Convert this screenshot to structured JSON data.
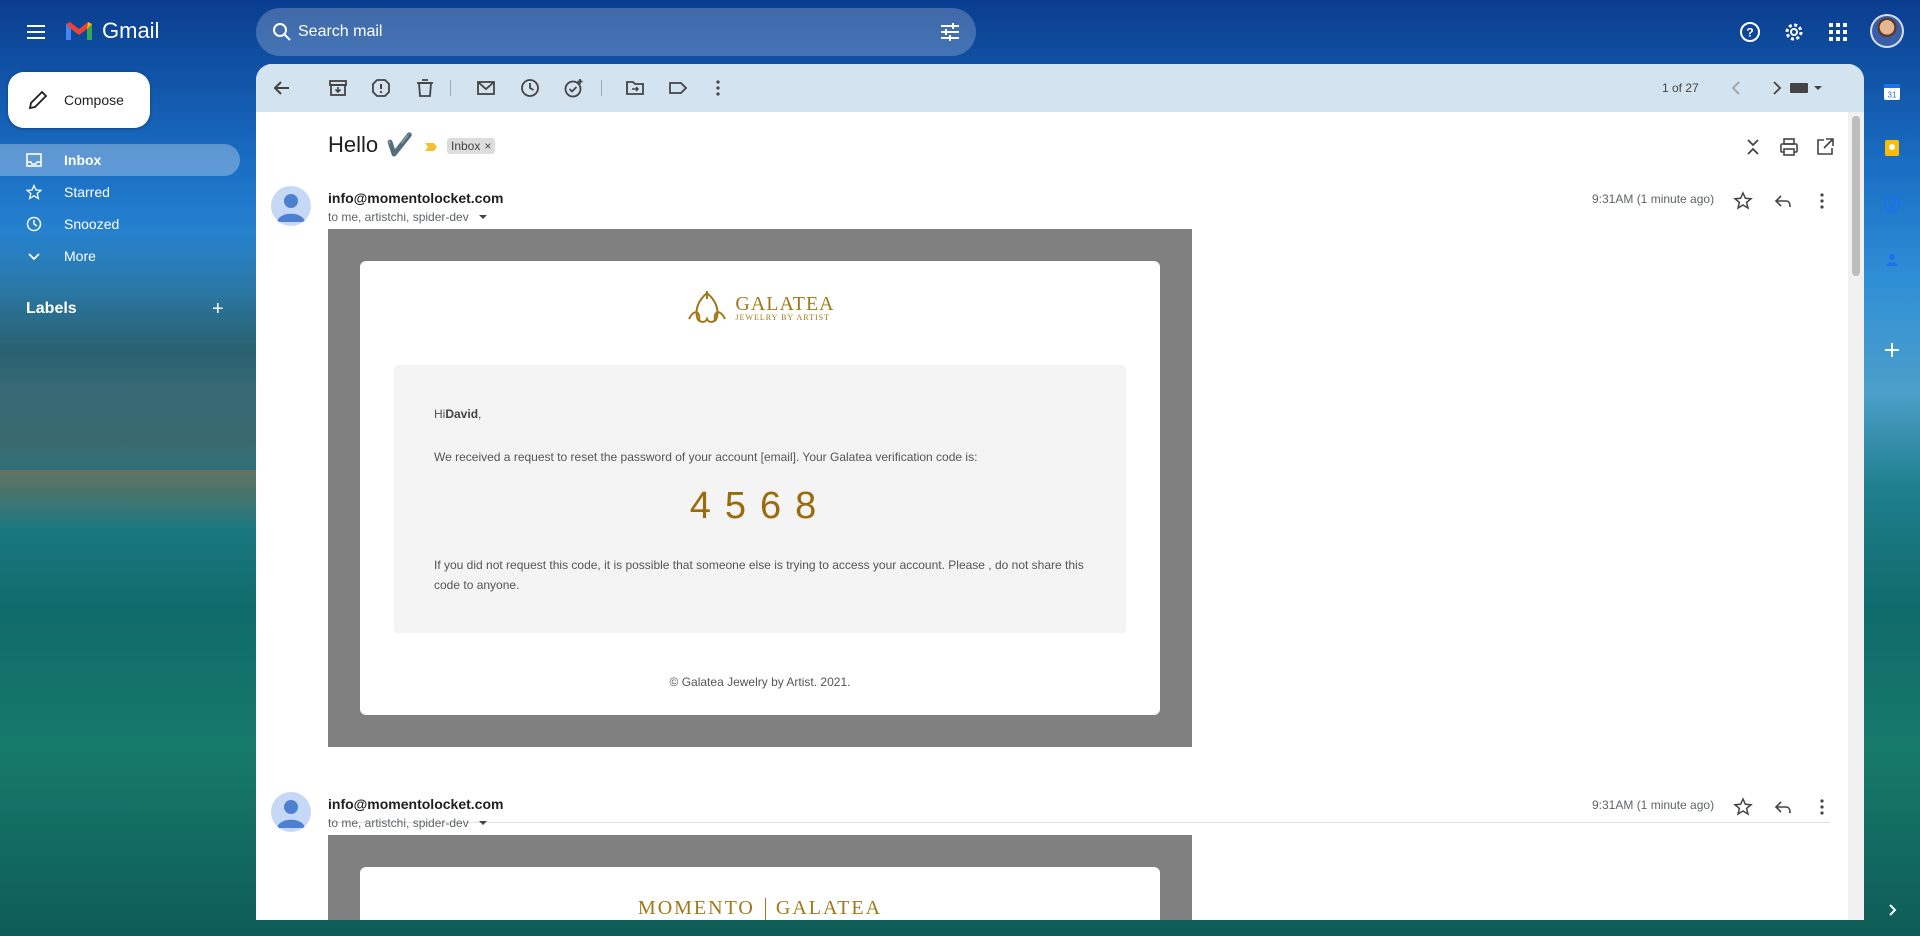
{
  "app": {
    "name": "Gmail"
  },
  "search": {
    "placeholder": "Search mail"
  },
  "sidebar": {
    "compose_label": "Compose",
    "items": [
      {
        "label": "Inbox",
        "icon": "inbox-icon",
        "active": true
      },
      {
        "label": "Starred",
        "icon": "star-icon"
      },
      {
        "label": "Snoozed",
        "icon": "clock-icon"
      },
      {
        "label": "More",
        "icon": "chevron-down-icon"
      }
    ],
    "labels_heading": "Labels"
  },
  "toolbar": {
    "pager": "1 of 27"
  },
  "thread": {
    "subject": "Hello",
    "subject_emoji": "✔️",
    "chip_label": "Inbox",
    "chip_close": "×"
  },
  "messages": [
    {
      "sender": "info@momentolocket.com",
      "recipients": "to me, artistchi, spider-dev",
      "time": "9:31AM (1 minute ago)",
      "brand_name": "GALATEA",
      "brand_sub": "JEWELRY BY ARTIST",
      "greeting_prefix": "Hi",
      "greeting_name": "David",
      "greeting_suffix": ",",
      "body": "We received a request to reset the password of your account [email]. Your Galatea verification code is:",
      "code": "4568",
      "warning": "If you did not request this code, it is possible that someone else is trying to access your account. Please , do not share this code to anyone.",
      "footer": "© Galatea Jewelry by Artist. 2021."
    },
    {
      "sender": "info@momentolocket.com",
      "recipients": "to me, artistchi, spider-dev",
      "time": "9:31AM (1 minute ago)",
      "brand_name": "MOMENTO",
      "brand_sub": "GALATEA"
    }
  ],
  "colors": {
    "accent": "#a07818",
    "code": "#9a6a0b",
    "toolbar": "#d3e3ef",
    "active_nav": "rgba(255,255,255,0.3)"
  }
}
